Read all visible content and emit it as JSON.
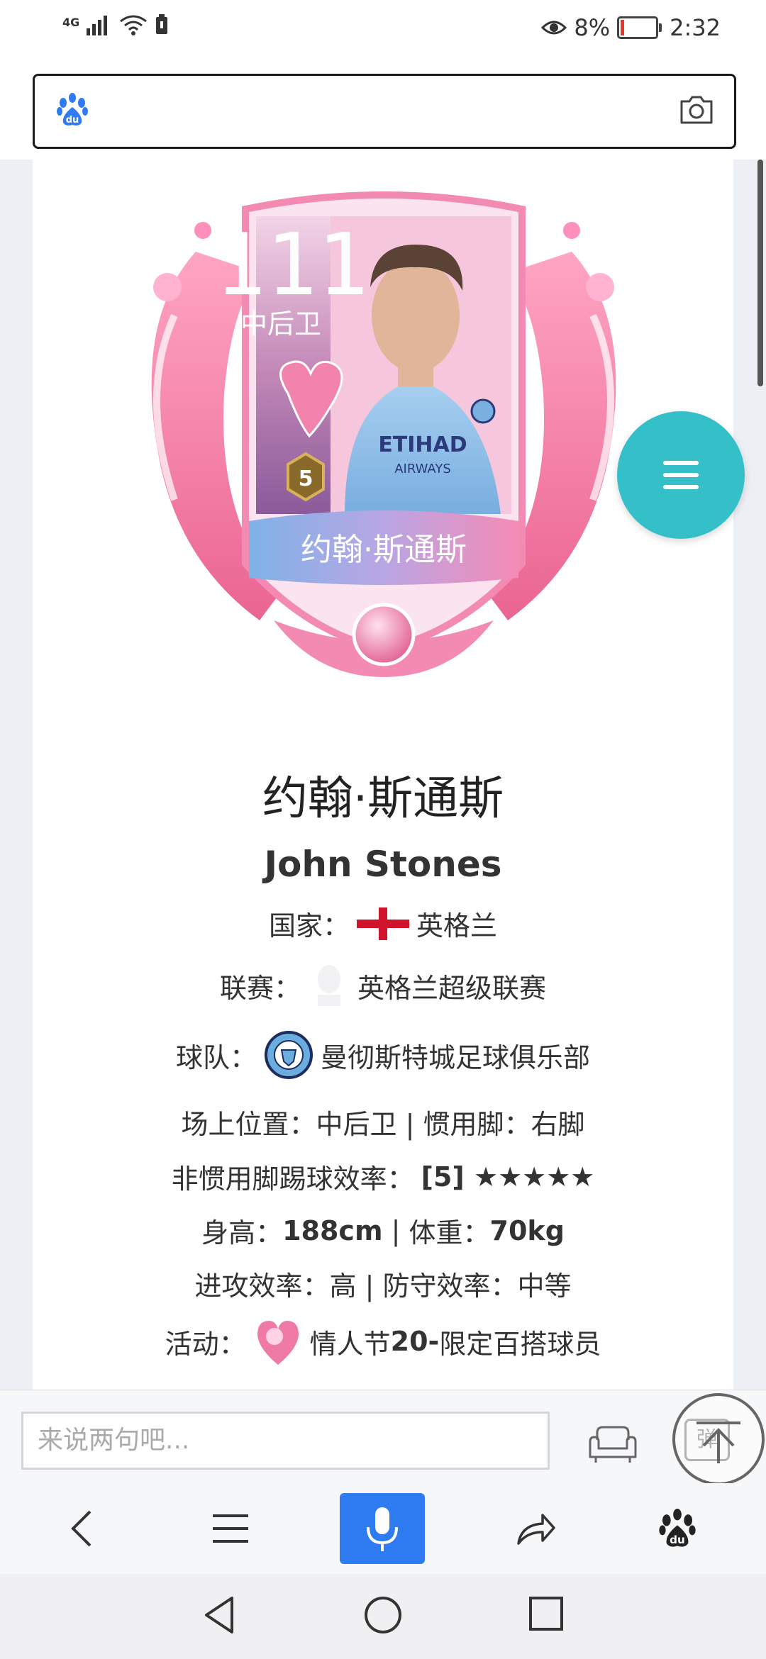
{
  "status_bar": {
    "network": "4G",
    "battery_percent": "8%",
    "time": "2:32"
  },
  "search": {
    "placeholder": ""
  },
  "player_card": {
    "rating": "111",
    "position": "中后卫",
    "rank": "5",
    "card_name": "约翰·斯通斯",
    "sponsor_main": "ETIHAD",
    "sponsor_sub": "AIRWAYS"
  },
  "player": {
    "name_cn": "约翰·斯通斯",
    "name_en": "John Stones",
    "country_label": "国家：",
    "country": "英格兰",
    "league_label": "联赛：",
    "league": "英格兰超级联赛",
    "team_label": "球队：",
    "team": "曼彻斯特城足球俱乐部",
    "position_line": "场上位置：中后卫 | 惯用脚：右脚",
    "weak_foot_label": "非惯用脚踢球效率：",
    "weak_foot_value": "[5] ★★★★★",
    "height_label": "身高：",
    "height": "188cm",
    "sep": " | ",
    "weight_label": "体重：",
    "weight": "70kg",
    "workrate_line": "进攻效率：高 | 防守效率：中等",
    "event_label": "活动：",
    "event_text": "情人节",
    "event_bold": "20-",
    "event_rest": "限定百搭球员"
  },
  "comment": {
    "placeholder": "来说两句吧...",
    "danmu_label": "弹"
  },
  "colors": {
    "fab": "#35c0c9",
    "voice": "#2f7cf2",
    "card_pink": "#f06a9a",
    "card_blue": "#7ab0e0"
  }
}
